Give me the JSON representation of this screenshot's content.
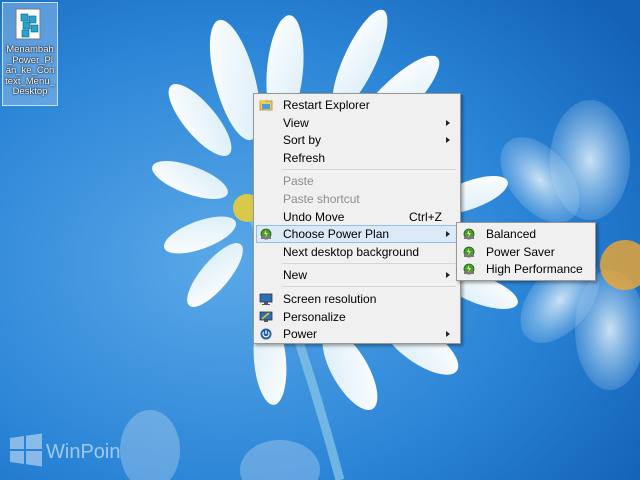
{
  "desktop": {
    "icon_label": "Menambah_Power_Plan_ke_Context_Menu_Desktop"
  },
  "context_menu": {
    "restart_explorer": "Restart Explorer",
    "view": "View",
    "sort_by": "Sort by",
    "refresh": "Refresh",
    "paste": "Paste",
    "paste_shortcut": "Paste shortcut",
    "undo_move": "Undo Move",
    "undo_shortcut": "Ctrl+Z",
    "choose_power_plan": "Choose Power Plan",
    "next_background": "Next desktop background",
    "new": "New",
    "screen_resolution": "Screen resolution",
    "personalize": "Personalize",
    "power": "Power"
  },
  "power_plan_submenu": {
    "items": [
      "Balanced",
      "Power Saver",
      "High Performance"
    ]
  },
  "watermark": {
    "text": "WinPoin"
  },
  "colors": {
    "sky": "#1f73c6",
    "menu_bg": "#f0f0f0",
    "highlight": "#dbe9f8"
  }
}
